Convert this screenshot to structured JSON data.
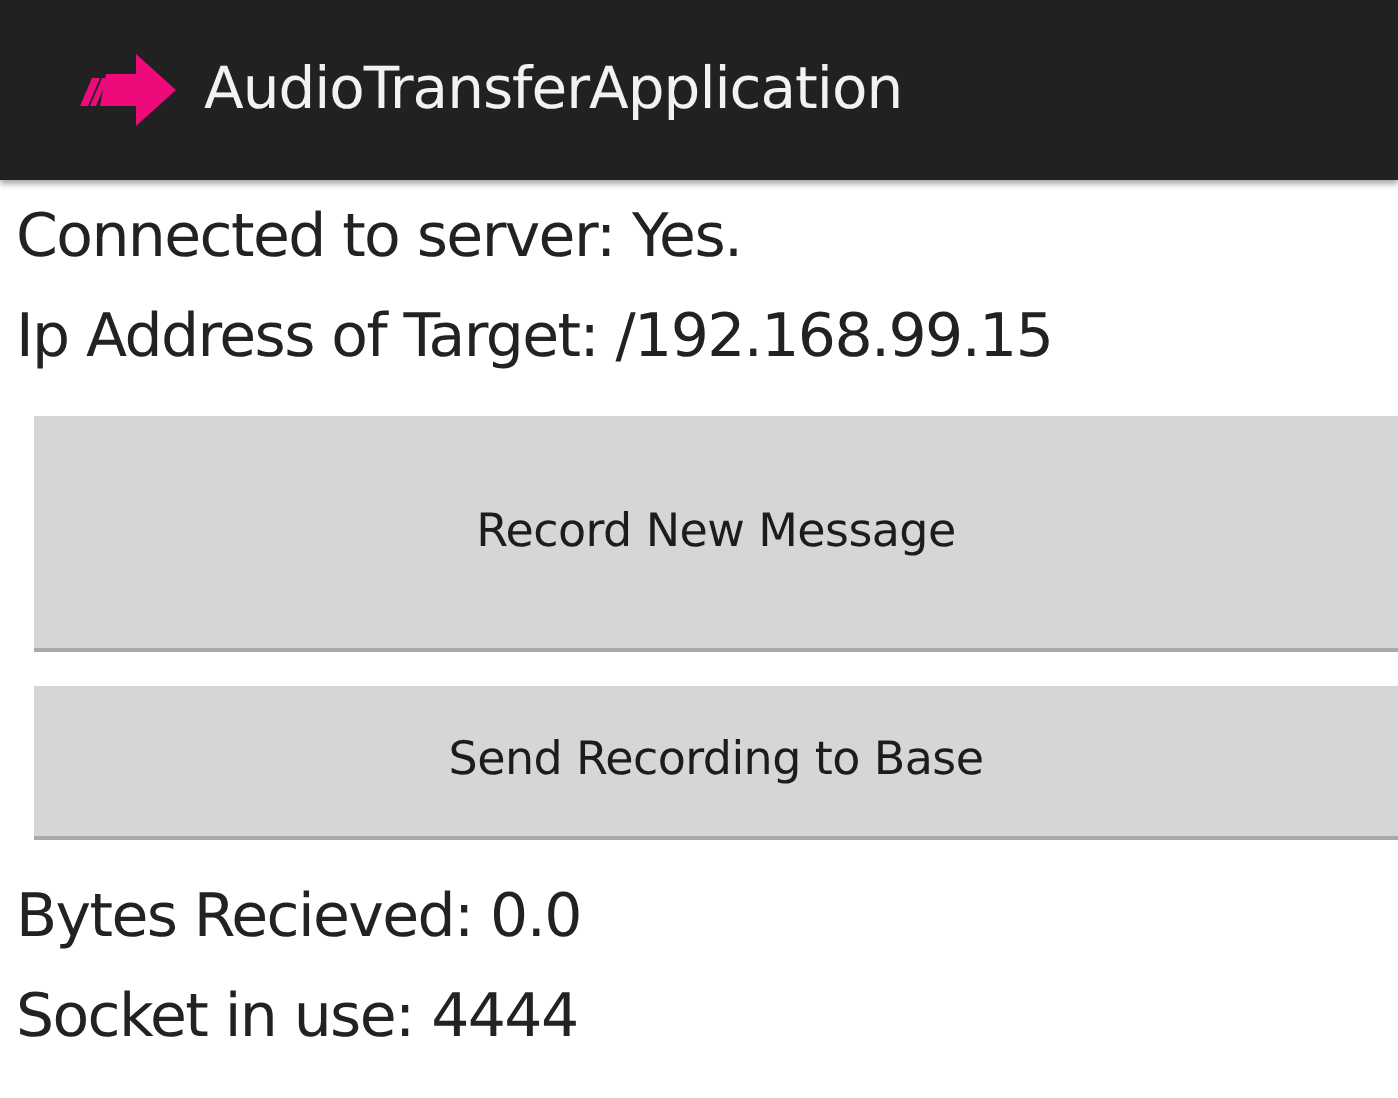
{
  "action_bar": {
    "title": "AudioTransferApplication"
  },
  "status_lines": [
    "Connected to server: Yes.",
    "Ip Address of Target: /192.168.99.15"
  ],
  "buttons": [
    "Record New Message",
    "Send Recording to Base"
  ],
  "info_lines": [
    "Bytes Recieved: 0.0",
    "Socket in use: 4444"
  ]
}
